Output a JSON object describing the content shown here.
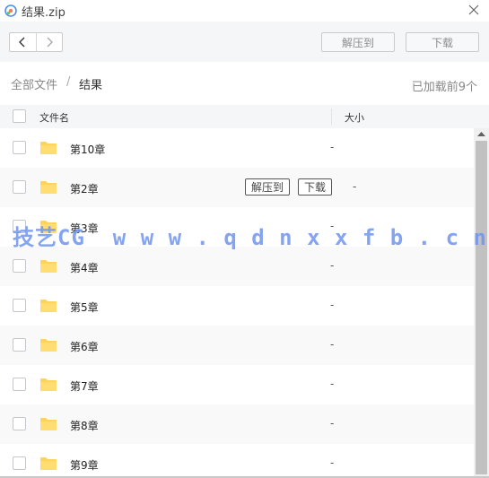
{
  "window": {
    "title": "结果.zip"
  },
  "toolbar": {
    "extract_label": "解压到",
    "download_label": "下载"
  },
  "breadcrumb": {
    "root": "全部文件",
    "separator": "/",
    "current": "结果"
  },
  "status": {
    "loaded": "已加载前9个"
  },
  "columns": {
    "name": "文件名",
    "size": "大小"
  },
  "rows": [
    {
      "name": "第10章",
      "size": "-"
    },
    {
      "name": "第2章",
      "size": "-",
      "actions": {
        "extract": "解压到",
        "download": "下载"
      }
    },
    {
      "name": "第3章",
      "size": "-"
    },
    {
      "name": "第4章",
      "size": "-"
    },
    {
      "name": "第5章",
      "size": "-"
    },
    {
      "name": "第6章",
      "size": "-"
    },
    {
      "name": "第7章",
      "size": "-"
    },
    {
      "name": "第8章",
      "size": "-"
    },
    {
      "name": "第9章",
      "size": "-"
    }
  ],
  "watermark": "技艺CG  w w w . q d n x x f b . c n",
  "icons": {
    "app": "cloud-icon",
    "close": "close-icon",
    "back": "chevron-left-icon",
    "forward": "chevron-right-icon",
    "folder": "folder-icon",
    "scroll_up": "arrow-up-icon"
  },
  "colors": {
    "folder": "#ffd25a",
    "app_icon": "#4e90e8",
    "watermark": "#6f95f0"
  }
}
